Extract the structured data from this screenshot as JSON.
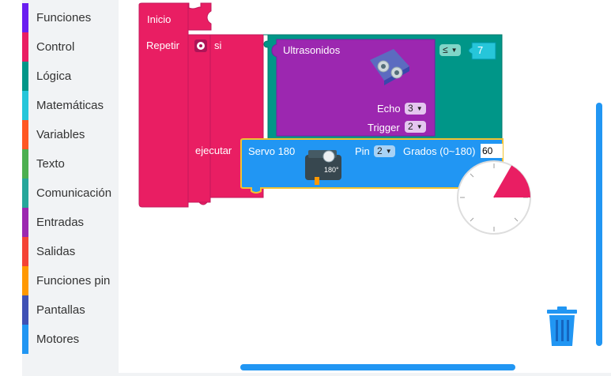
{
  "toolbox": {
    "items": [
      {
        "label": "Funciones",
        "color": "#6a1ef0"
      },
      {
        "label": "Control",
        "color": "#e91e63"
      },
      {
        "label": "Lógica",
        "color": "#009688"
      },
      {
        "label": "Matemáticas",
        "color": "#26c6da"
      },
      {
        "label": "Variables",
        "color": "#ff5722"
      },
      {
        "label": "Texto",
        "color": "#4caf50"
      },
      {
        "label": "Comunicación",
        "color": "#26a69a"
      },
      {
        "label": "Entradas",
        "color": "#9c27b0"
      },
      {
        "label": "Salidas",
        "color": "#f44336"
      },
      {
        "label": "Funciones pin",
        "color": "#ff9800"
      },
      {
        "label": "Pantallas",
        "color": "#3f51b5"
      },
      {
        "label": "Motores",
        "color": "#2196f3"
      }
    ]
  },
  "blocks": {
    "inicio_label": "Inicio",
    "repetir_label": "Repetir",
    "si_label": "si",
    "ejecutar_label": "ejecutar",
    "ultrasonidos": {
      "label": "Ultrasonidos",
      "echo_label": "Echo",
      "echo_value": "3",
      "trigger_label": "Trigger",
      "trigger_value": "2"
    },
    "compare": {
      "operator": "≤",
      "value": "7"
    },
    "servo": {
      "label": "Servo 180",
      "image_text": "180°",
      "pin_label": "Pin",
      "pin_value": "2",
      "grados_label": "Grados (0~180)",
      "grados_value": "60"
    }
  },
  "colors": {
    "control": "#e91e63",
    "logic": "#009688",
    "sensor": "#9c27b0",
    "motor": "#2196f3",
    "accent": "#2196f3"
  },
  "icons": {
    "gear": "gear-icon",
    "trash": "trash-icon",
    "sensor_image": "ultrasonic-sensor-image",
    "servo_image": "servo-motor-image",
    "angle_dial": "angle-picker-dial"
  }
}
